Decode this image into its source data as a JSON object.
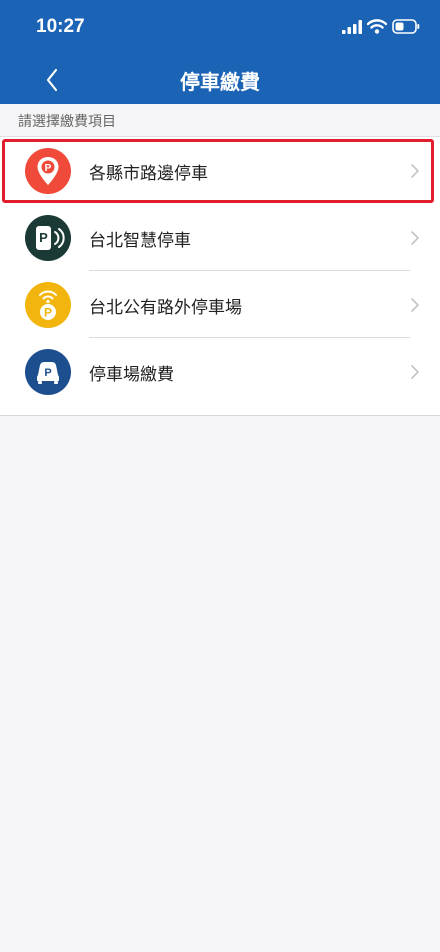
{
  "status_bar": {
    "time": "10:27"
  },
  "nav": {
    "title": "停車繳費",
    "back_icon": "chevron-left-icon"
  },
  "section_label": "請選擇繳費項目",
  "colors": {
    "header_bg": "#1a63b5",
    "highlight": "#e11d2e",
    "icon_roadside": "#ef4a3a",
    "icon_smart": "#1b3a36",
    "icon_offstreet": "#f1b50d",
    "icon_lot": "#1d4f8f"
  },
  "items": [
    {
      "label": "各縣市路邊停車",
      "icon": "map-pin-parking-icon",
      "highlighted": true
    },
    {
      "label": "台北智慧停車",
      "icon": "smart-parking-meter-icon"
    },
    {
      "label": "台北公有路外停車場",
      "icon": "wireless-parking-icon"
    },
    {
      "label": "停車場繳費",
      "icon": "parking-car-icon"
    }
  ]
}
